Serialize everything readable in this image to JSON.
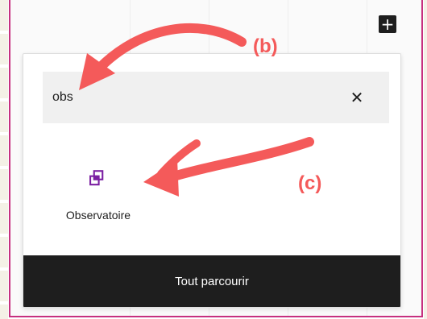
{
  "toolbar": {
    "add_icon": "plus-icon"
  },
  "search": {
    "value": "obs",
    "clear_icon": "close-icon"
  },
  "results": [
    {
      "label": "Observatoire",
      "icon": "group-blocks-icon",
      "icon_color": "#7b1fa2"
    }
  ],
  "footer": {
    "label": "Tout parcourir"
  },
  "annotations": {
    "b": "(b)",
    "c": "(c)"
  },
  "colors": {
    "accent": "#c6307f",
    "arrow": "#f45a5a",
    "dark": "#1e1e1e"
  }
}
